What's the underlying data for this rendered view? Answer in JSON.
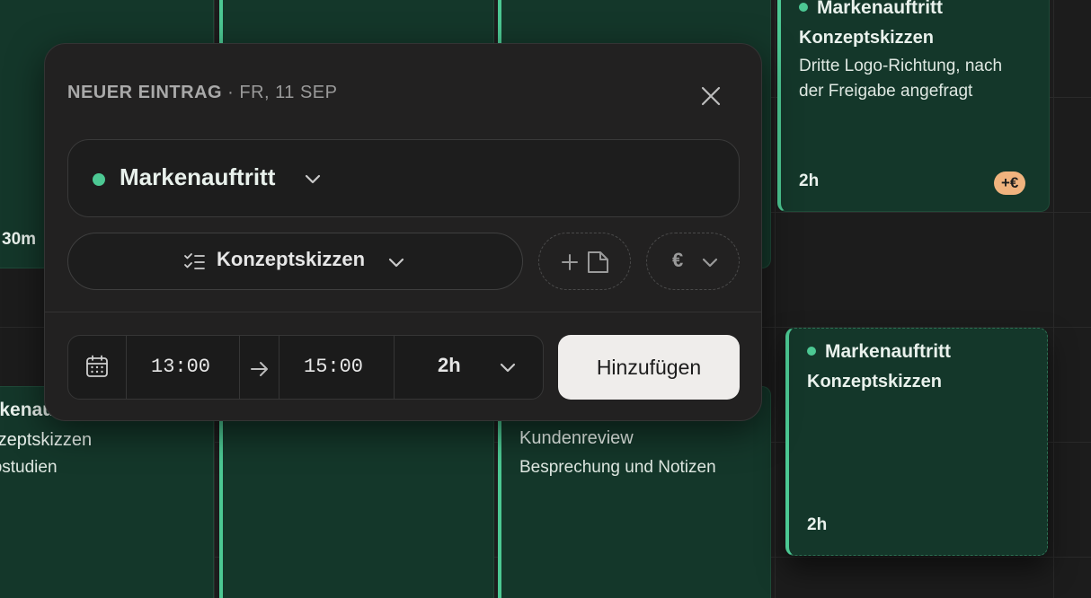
{
  "background_events": [
    {
      "id": "tl",
      "duration": "30m"
    },
    {
      "id": "bl",
      "project": "Markenauftritt",
      "task": "Konzeptskizzen",
      "note": "Logostudien"
    },
    {
      "id": "bm",
      "task": "Kundenreview",
      "note": "Besprechung und Notizen"
    },
    {
      "id": "tr",
      "project": "Markenauftritt",
      "task": "Konzeptskizzen",
      "note": "Dritte Logo-Richtung, nach der Freigabe angefragt",
      "duration": "2h",
      "badge": "+€"
    },
    {
      "id": "draft",
      "project": "Markenauftritt",
      "task": "Konzeptskizzen",
      "duration": "2h"
    }
  ],
  "modal": {
    "title_strong": "NEUER EINTRAG",
    "title_date": " · FR, 11 SEP",
    "project_label": "Markenauftritt",
    "task_label": "Konzeptskizzen",
    "currency_symbol": "€",
    "start_time": "13:00",
    "end_time": "15:00",
    "duration": "2h",
    "add_button": "Hinzufügen"
  },
  "icons": [
    "close-icon",
    "chevron-down-icon",
    "task-list-icon",
    "add-file-icon",
    "euro-icon",
    "calendar-icon",
    "arrow-right-icon"
  ],
  "colors": {
    "accent": "#4cc893",
    "event_bg": "#14372a",
    "badge": "#f0b37e",
    "modal_bg": "#222121",
    "button_bg": "#efedeb"
  }
}
